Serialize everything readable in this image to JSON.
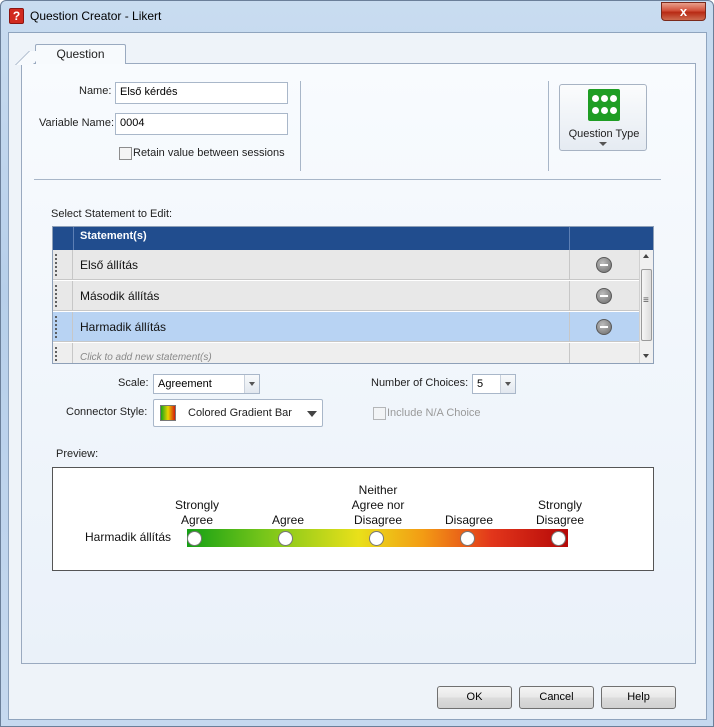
{
  "window": {
    "title": "Question Creator - Likert",
    "close_label": "x"
  },
  "tab": {
    "label": "Question"
  },
  "form": {
    "name_label": "Name:",
    "name_value": "Első kérdés",
    "variable_label": "Variable Name:",
    "variable_value": "0004",
    "retain_label": "Retain value between sessions",
    "retain_checked": false
  },
  "question_type": {
    "label": "Question Type",
    "icon": "dots-grid-icon"
  },
  "statements": {
    "select_label": "Select Statement to Edit:",
    "header": "Statement(s)",
    "items": [
      {
        "label": "Első állítás",
        "selected": false
      },
      {
        "label": "Második állítás",
        "selected": false
      },
      {
        "label": "Harmadik állítás",
        "selected": true
      }
    ],
    "add_hint": "Click to add new statement(s)"
  },
  "options": {
    "scale_label": "Scale:",
    "scale_value": "Agreement",
    "choices_label": "Number of Choices:",
    "choices_value": "5",
    "connector_label": "Connector Style:",
    "connector_value": "Colored Gradient Bar",
    "na_label": "Include N/A Choice",
    "na_checked": false
  },
  "preview": {
    "label": "Preview:",
    "statement": "Harmadik állítás",
    "choices": [
      {
        "line1": "Strongly",
        "line2": "Agree",
        "line3": ""
      },
      {
        "line1": "Agree",
        "line2": "",
        "line3": ""
      },
      {
        "line1": "Neither",
        "line2": "Agree nor",
        "line3": "Disagree"
      },
      {
        "line1": "Disagree",
        "line2": "",
        "line3": ""
      },
      {
        "line1": "Strongly",
        "line2": "Disagree",
        "line3": ""
      }
    ],
    "gradient_colors": [
      "#14a014",
      "#e9e01a",
      "#b50808"
    ]
  },
  "buttons": {
    "ok": "OK",
    "cancel": "Cancel",
    "help": "Help"
  }
}
